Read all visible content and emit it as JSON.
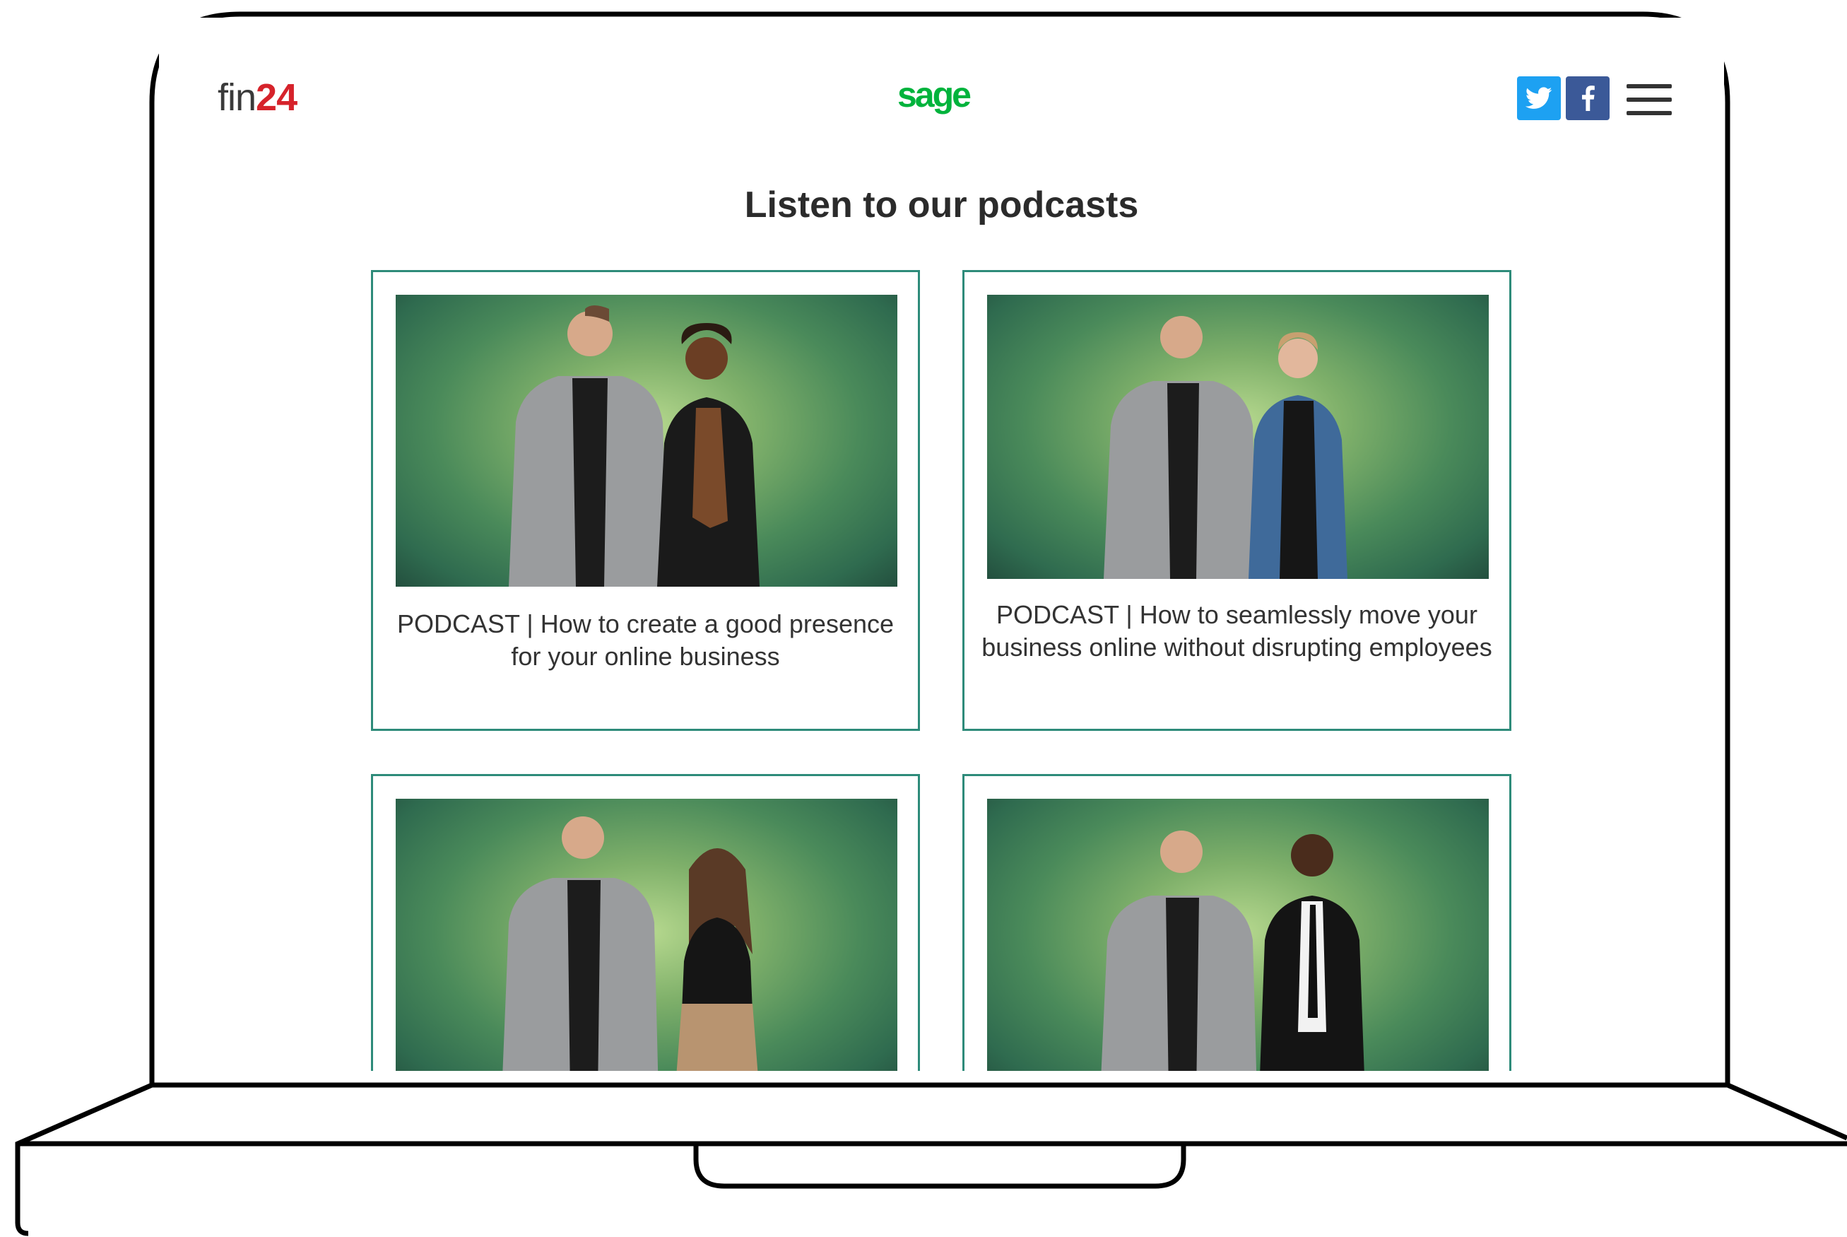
{
  "header": {
    "brand_fin_text": "fin",
    "brand_fin_number": "24",
    "brand_sage": "sage",
    "social": [
      "twitter-icon",
      "facebook-icon"
    ],
    "menu_icon": "hamburger-menu-icon"
  },
  "page": {
    "title": "Listen to our podcasts"
  },
  "podcasts": [
    {
      "caption": "PODCAST | How to create a good presence for your online business"
    },
    {
      "caption": "PODCAST | How to seamlessly move your business online without disrupting employees"
    },
    {
      "caption": ""
    },
    {
      "caption": ""
    }
  ],
  "colors": {
    "accent_border": "#2e8b7a",
    "fin24_red": "#d6232b",
    "sage_green": "#00b33c",
    "twitter": "#1da1f2",
    "facebook": "#3b5998"
  }
}
